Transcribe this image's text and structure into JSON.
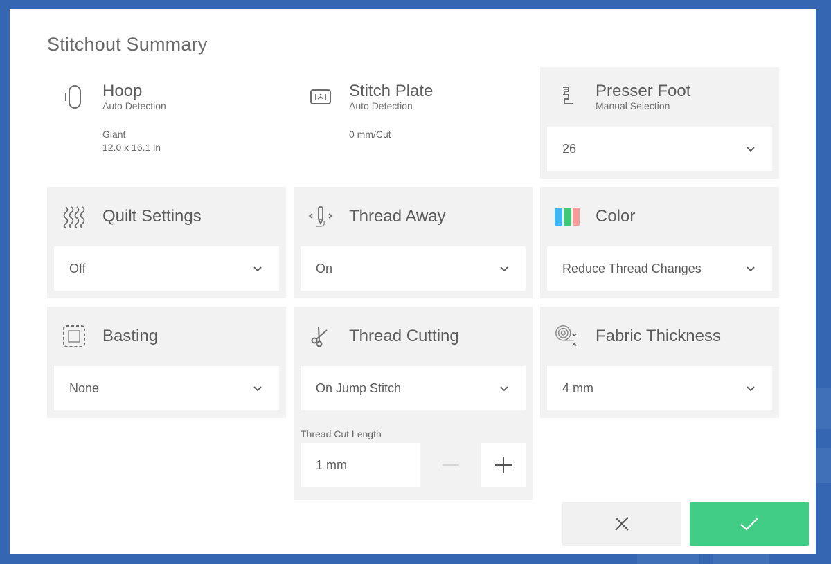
{
  "dialog": {
    "title": "Stitchout Summary"
  },
  "colors": {
    "background": "#3466b1",
    "card": "#f2f2f2",
    "confirm": "#41cd85",
    "color_icon": [
      "#3fb6f5",
      "#3ec877",
      "#f79b9b"
    ]
  },
  "hoop": {
    "icon": "hoop-icon",
    "title": "Hoop",
    "subtitle": "Auto Detection",
    "size_name": "Giant",
    "size_dims": "12.0 x 16.1 in"
  },
  "stitch_plate": {
    "icon": "stitch-plate-icon",
    "title": "Stitch Plate",
    "subtitle": "Auto Detection",
    "value": "0 mm/Cut"
  },
  "presser_foot": {
    "icon": "presser-foot-icon",
    "title": "Presser Foot",
    "subtitle": "Manual Selection",
    "value": "26"
  },
  "quilt_settings": {
    "icon": "quilt-icon",
    "title": "Quilt Settings",
    "value": "Off"
  },
  "thread_away": {
    "icon": "thread-away-icon",
    "title": "Thread Away",
    "value": "On"
  },
  "color": {
    "icon": "color-bars-icon",
    "title": "Color",
    "value": "Reduce Thread Changes"
  },
  "basting": {
    "icon": "basting-icon",
    "title": "Basting",
    "value": "None"
  },
  "thread_cutting": {
    "icon": "scissors-icon",
    "title": "Thread Cutting",
    "value": "On Jump Stitch",
    "cut_length_label": "Thread Cut Length",
    "cut_length_value": "1 mm"
  },
  "fabric_thickness": {
    "icon": "fabric-roll-icon",
    "title": "Fabric Thickness",
    "value": "4 mm"
  },
  "footer": {
    "cancel_icon": "close-icon",
    "confirm_icon": "check-icon"
  }
}
